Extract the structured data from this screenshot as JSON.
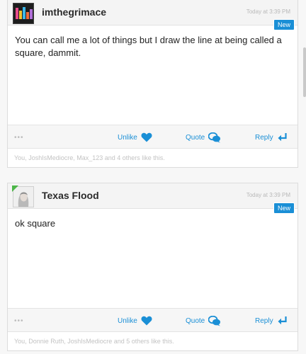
{
  "posts": [
    {
      "username": "imthegrimace",
      "timestamp": "Today at 3:39 PM",
      "badge": "New",
      "body": "You can call me a lot of things but I draw the line at being called a square, dammit.",
      "more": "•••",
      "actions": {
        "unlike": "Unlike",
        "quote": "Quote",
        "reply": "Reply"
      },
      "likes": "You, JoshIsMediocre, Max_123 and 4 others like this."
    },
    {
      "username": "Texas Flood",
      "timestamp": "Today at 3:39 PM",
      "badge": "New",
      "body": "ok square",
      "more": "•••",
      "actions": {
        "unlike": "Unlike",
        "quote": "Quote",
        "reply": "Reply"
      },
      "likes": "You, Donnie Ruth, JoshIsMediocre and 5 others like this."
    }
  ],
  "colors": {
    "accent": "#1a8fd6",
    "online": "#4cb648"
  }
}
